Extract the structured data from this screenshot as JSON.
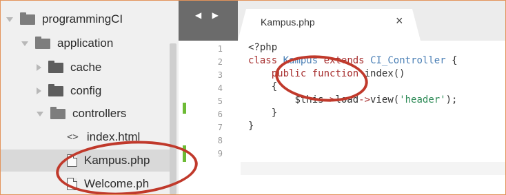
{
  "sidebar": {
    "items": [
      {
        "label": "programmingCI",
        "icon": "folder-open-icon",
        "expanded": true
      },
      {
        "label": "application",
        "icon": "folder-open-icon",
        "expanded": true
      },
      {
        "label": "cache",
        "icon": "folder-icon",
        "expanded": false
      },
      {
        "label": "config",
        "icon": "folder-icon",
        "expanded": false
      },
      {
        "label": "controllers",
        "icon": "folder-open-icon",
        "expanded": true
      },
      {
        "label": "index.html",
        "icon": "code-file-icon"
      },
      {
        "label": "Kampus.php",
        "icon": "file-icon",
        "selected": true
      },
      {
        "label": "Welcome.ph",
        "icon": "file-icon"
      }
    ]
  },
  "editor": {
    "nav": "◀ ▶",
    "tab": {
      "title": "Kampus.php",
      "close": "×"
    },
    "line_numbers": [
      "1",
      "2",
      "3",
      "4",
      "5",
      "6",
      "7",
      "8",
      "9"
    ],
    "code": {
      "l1": "<?php",
      "l2_class": "class",
      "l2_name": "Kampus",
      "l2_extends": "extends",
      "l2_parent": "CI_Controller",
      "l2_brace": " {",
      "l3_public": "public",
      "l3_function": "function",
      "l3_rest": " index()",
      "l4": "{",
      "l5_this": "$this",
      "l5_arrow1": "->",
      "l5_load": "load",
      "l5_arrow2": "->",
      "l5_view": "view(",
      "l5_str": "'header'",
      "l5_end": ");",
      "l6": "}",
      "l7": "}"
    }
  },
  "colors": {
    "annotation": "#c0392b",
    "modified_marker": "#6dbb35"
  }
}
